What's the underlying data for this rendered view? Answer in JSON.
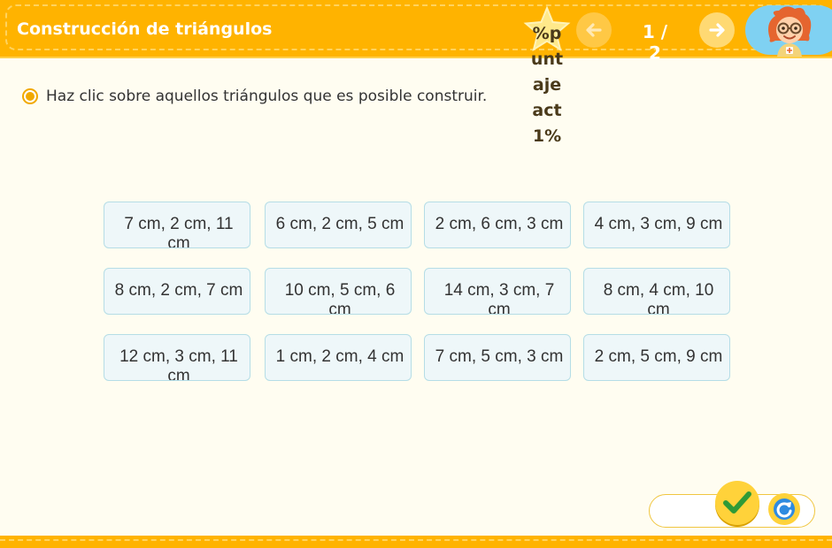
{
  "header": {
    "title": "Construcción de triángulos",
    "score_text": "%puntajeact1%",
    "page_indicator": "1 / 2",
    "prev_icon": "arrow-left-icon",
    "next_icon": "arrow-right-icon",
    "avatar_icon": "character-avatar"
  },
  "instruction": {
    "text": "Haz clic sobre aquellos triángulos que es posible construir."
  },
  "options": [
    "7 cm, 2 cm, 11 cm",
    "6 cm, 2 cm, 5 cm",
    "2 cm, 6 cm, 3 cm",
    "4 cm, 3 cm, 9 cm",
    "8 cm, 2 cm, 7 cm",
    "10 cm, 5 cm, 6 cm",
    "14 cm, 3 cm, 7 cm",
    "8 cm, 4 cm, 10 cm",
    "12 cm, 3 cm, 11 cm",
    "1 cm, 2 cm, 4 cm",
    "7 cm, 5 cm, 3 cm",
    "2 cm, 5 cm, 9 cm"
  ],
  "footer": {
    "check_icon": "check-icon",
    "reset_icon": "reset-icon"
  },
  "colors": {
    "accent": "#ffb300",
    "option_bg": "#eef7f9",
    "option_border": "#b5dde6",
    "page_bg": "#fffdf1"
  }
}
